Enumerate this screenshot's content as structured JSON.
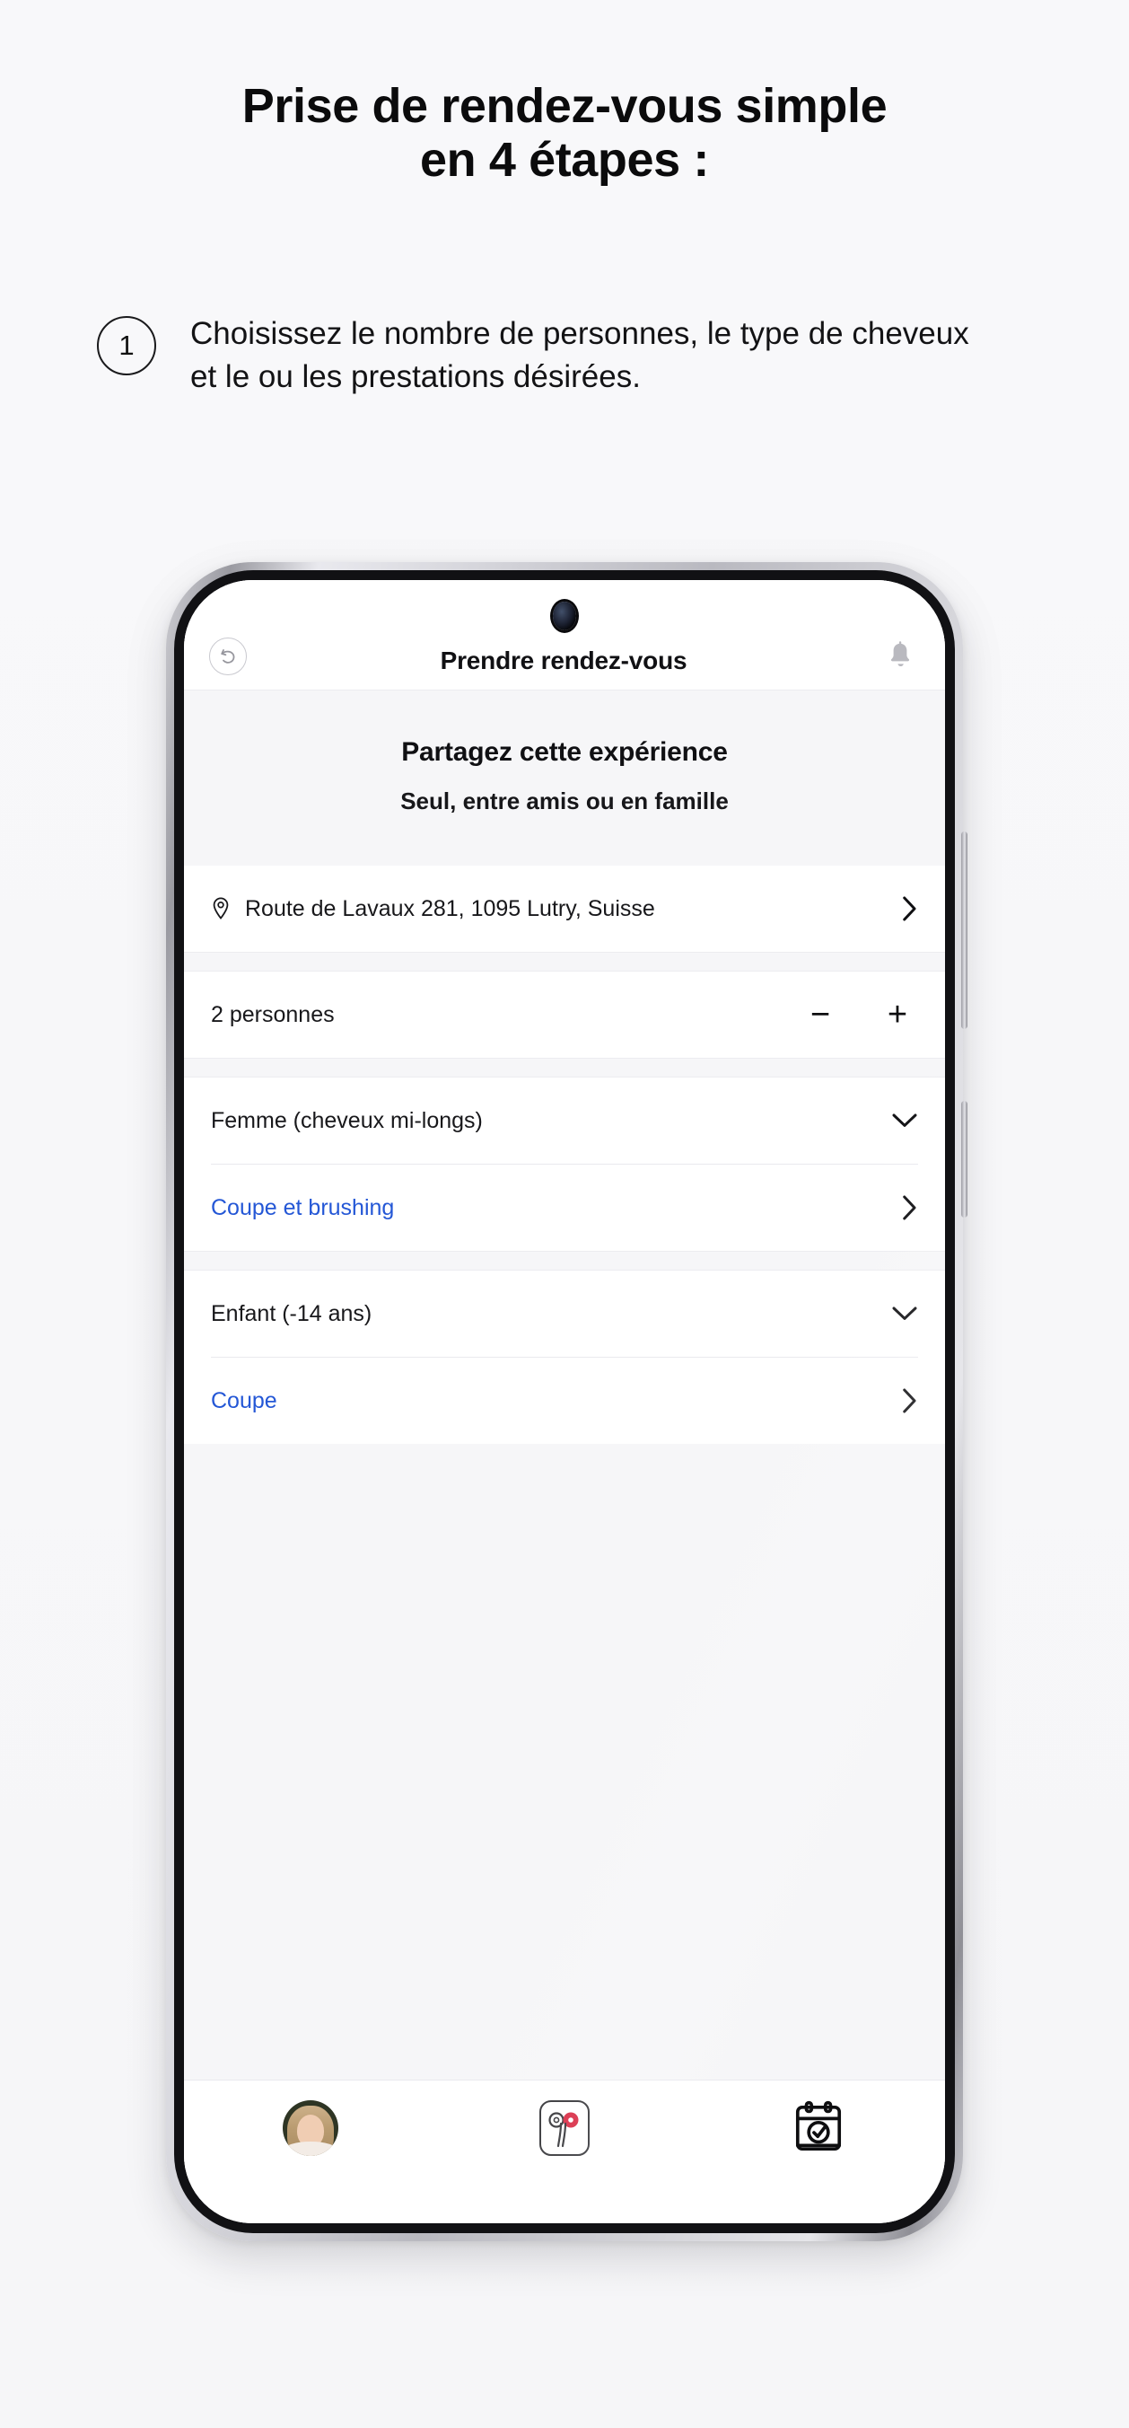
{
  "headline": {
    "line1": "Prise de rendez-vous simple",
    "line2": "en 4 étapes :"
  },
  "step": {
    "number": "1",
    "text": "Choisissez le nombre de personnes, le type de cheveux et le ou les prestations désirées."
  },
  "phone": {
    "appbar": {
      "back_icon": "back-undo-icon",
      "title": "Prendre rendez-vous",
      "bell_icon": "bell-icon"
    },
    "hero": {
      "title": "Partagez cette expérience",
      "subtitle": "Seul, entre amis ou en famille"
    },
    "address_row": {
      "icon": "location-pin-icon",
      "label": "Route de Lavaux 281, 1095 Lutry, Suisse",
      "chevron": "chevron-right-icon"
    },
    "persons_row": {
      "label": "2 personnes",
      "minus": "−",
      "plus": "+"
    },
    "selections": [
      {
        "type_label": "Femme (cheveux mi-longs)",
        "type_chevron": "chevron-down-icon",
        "service_label": "Coupe et brushing",
        "service_chevron": "chevron-right-icon"
      },
      {
        "type_label": "Enfant (-14 ans)",
        "type_chevron": "chevron-down-icon",
        "service_label": "Coupe",
        "service_chevron": "chevron-right-icon"
      }
    ],
    "tabbar": [
      {
        "name": "profile-avatar"
      },
      {
        "name": "app-logo-scissors-icon"
      },
      {
        "name": "calendar-check-icon"
      }
    ]
  },
  "colors": {
    "link": "#2457d6",
    "text": "#18181b",
    "page_bg": "#f7f7f9",
    "panel_bg": "#f6f6f8",
    "logo_red": "#d6203b"
  }
}
